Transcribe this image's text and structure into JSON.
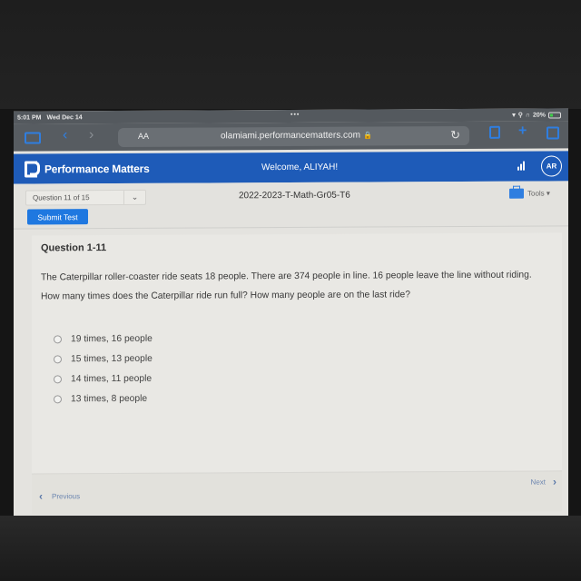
{
  "status_bar": {
    "time": "5:01 PM",
    "date": "Wed Dec 14",
    "more": "•••",
    "battery": "20%"
  },
  "browser": {
    "aa_label": "AA",
    "url": "olamiami.performancematters.com",
    "lock_icon": "🔒",
    "reload_icon": "↻",
    "back_icon": "‹",
    "forward_icon": "›",
    "new_tab_icon": "+"
  },
  "app": {
    "brand": "Performance Matters",
    "welcome": "Welcome, ALIYAH!",
    "avatar_initials": "AR",
    "brand_color": "#1e5bb8"
  },
  "sub_header": {
    "question_selector": "Question 11 of 15",
    "chevron": "⌄",
    "test_name": "2022-2023-T-Math-Gr05-T6",
    "tools_label": "Tools ▾",
    "submit_label": "Submit Test",
    "submit_color": "#1f78e0"
  },
  "question": {
    "title": "Question 1-11",
    "text": "The Caterpillar roller-coaster ride seats 18 people. There are 374 people in line. 16 people leave the line without riding.  How many times does the Caterpillar ride run full? How many people are on the last ride?",
    "options": [
      {
        "label": "19 times, 16 people"
      },
      {
        "label": "15 times, 13 people"
      },
      {
        "label": "14 times, 11 people"
      },
      {
        "label": "13 times, 8 people"
      }
    ]
  },
  "footer": {
    "previous_label": "Previous",
    "next_label": "Next",
    "prev_icon": "‹",
    "next_icon": "›"
  }
}
